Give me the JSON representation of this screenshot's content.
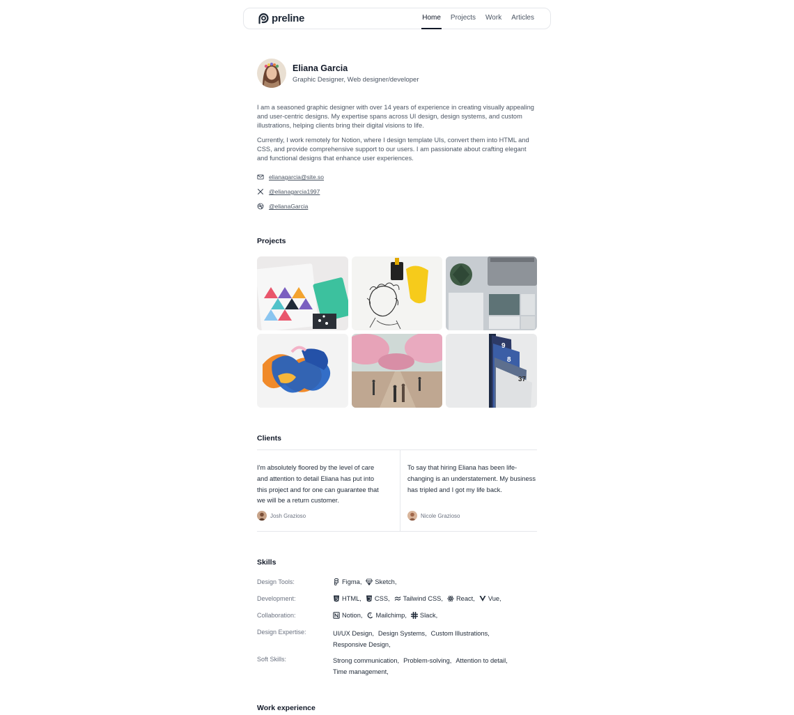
{
  "header": {
    "brand": "preline",
    "nav": [
      {
        "label": "Home",
        "active": true
      },
      {
        "label": "Projects",
        "active": false
      },
      {
        "label": "Work",
        "active": false
      },
      {
        "label": "Articles",
        "active": false
      }
    ]
  },
  "profile": {
    "name": "Eliana Garcia",
    "role": "Graphic Designer, Web designer/developer",
    "bio": [
      "I am a seasoned graphic designer with over 14 years of experience in creating visually appealing and user-centric designs. My expertise spans across UI design, design systems, and custom illustrations, helping clients bring their digital visions to life.",
      "Currently, I work remotely for Notion, where I design template UIs, convert them into HTML and CSS, and provide comprehensive support to our users. I am passionate about crafting elegant and functional designs that enhance user experiences."
    ],
    "contacts": [
      {
        "icon": "mail-icon",
        "text": "elianagarcia@site.so"
      },
      {
        "icon": "x-twitter-icon",
        "text": "@elianagarcia1997"
      },
      {
        "icon": "dribbble-icon",
        "text": "@elianaGarcia"
      }
    ]
  },
  "projects": {
    "title": "Projects",
    "images": [
      "geometric-cards-image",
      "ink-bottles-sketch-image",
      "stationery-laptop-image",
      "paint-strokes-image",
      "cherry-blossom-park-image",
      "numbered-cards-image"
    ]
  },
  "clients": {
    "title": "Clients",
    "testimonials": [
      {
        "quote": "I'm absolutely floored by the level of care and attention to detail Eliana has put into this project and for one can guarantee that we will be a return customer.",
        "author": "Josh Grazioso"
      },
      {
        "quote": "To say that hiring Eliana has been life-changing is an understatement. My business has tripled and I got my life back.",
        "author": "Nicole Grazioso"
      }
    ]
  },
  "skills": {
    "title": "Skills",
    "rows": [
      {
        "label": "Design Tools:",
        "items": [
          {
            "icon": "figma-icon",
            "text": "Figma,"
          },
          {
            "icon": "sketch-icon",
            "text": "Sketch,"
          }
        ]
      },
      {
        "label": "Development:",
        "items": [
          {
            "icon": "html5-icon",
            "text": "HTML,"
          },
          {
            "icon": "css3-icon",
            "text": "CSS,"
          },
          {
            "icon": "tailwind-icon",
            "text": "Tailwind CSS,"
          },
          {
            "icon": "react-icon",
            "text": "React,"
          },
          {
            "icon": "vue-icon",
            "text": "Vue,"
          }
        ]
      },
      {
        "label": "Collaboration:",
        "items": [
          {
            "icon": "notion-icon",
            "text": "Notion,"
          },
          {
            "icon": "mailchimp-icon",
            "text": "Mailchimp,"
          },
          {
            "icon": "slack-icon",
            "text": "Slack,"
          }
        ]
      },
      {
        "label": "Design Expertise:",
        "items": [
          {
            "text": "UI/UX Design,"
          },
          {
            "text": "Design Systems,"
          },
          {
            "text": "Custom Illustrations,"
          },
          {
            "text": "Responsive Design,"
          }
        ]
      },
      {
        "label": "Soft Skills:",
        "items": [
          {
            "text": "Strong communication,"
          },
          {
            "text": "Problem-solving,"
          },
          {
            "text": "Attention to detail,"
          },
          {
            "text": "Time management,"
          }
        ]
      }
    ]
  },
  "work": {
    "title": "Work experience"
  }
}
